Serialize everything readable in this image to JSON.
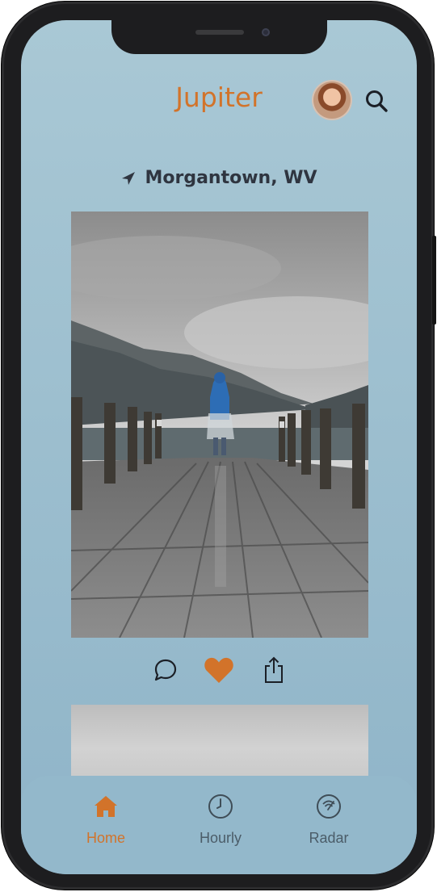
{
  "app": {
    "title": "Jupiter"
  },
  "header": {
    "avatar": "profile-avatar",
    "search_icon": "search-icon"
  },
  "location": {
    "text": "Morgantown, WV",
    "icon": "location-arrow-icon"
  },
  "post": {
    "image": "rainy-lake-pier-photo",
    "actions": [
      {
        "name": "comment",
        "icon": "comment-icon"
      },
      {
        "name": "like",
        "icon": "heart-icon",
        "active": true
      },
      {
        "name": "share",
        "icon": "share-icon"
      }
    ]
  },
  "tabs": [
    {
      "label": "Home",
      "icon": "home-icon",
      "active": true
    },
    {
      "label": "Hourly",
      "icon": "clock-icon",
      "active": false
    },
    {
      "label": "Radar",
      "icon": "radar-icon",
      "active": false
    }
  ],
  "colors": {
    "accent": "#d2732a",
    "background": "#a9c8d5",
    "tabbar": "#93b8cb",
    "text": "#2f3540"
  }
}
